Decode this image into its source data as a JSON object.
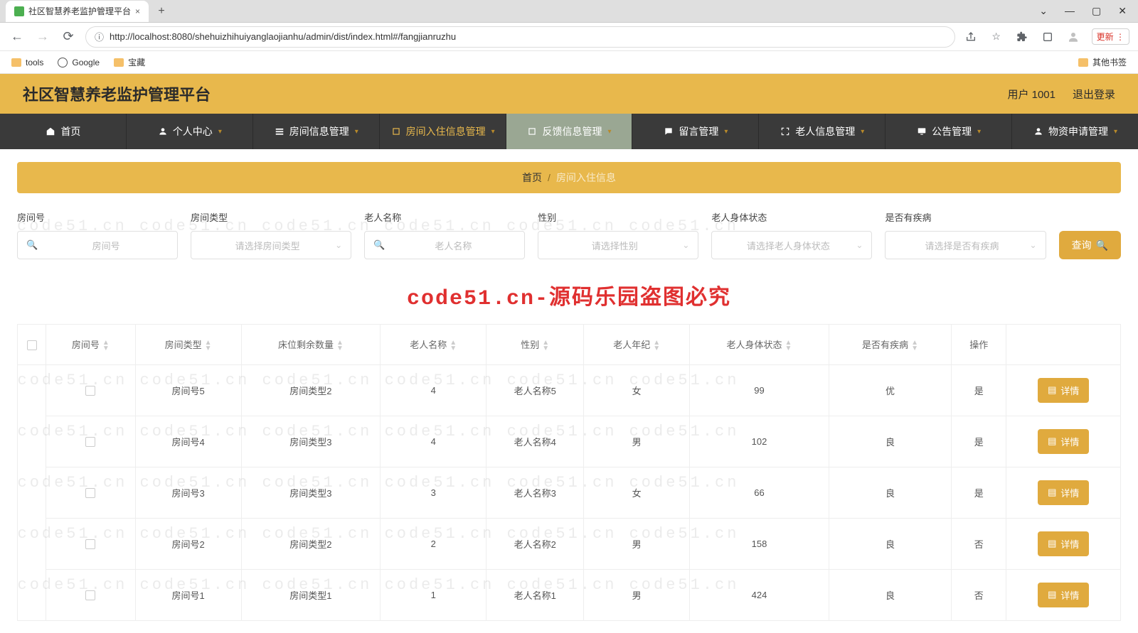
{
  "browser": {
    "tab_title": "社区智慧养老监护管理平台",
    "url": "http://localhost:8080/shehuizhihuiyanglaojianhu/admin/dist/index.html#/fangjianruzhu",
    "update_label": "更新",
    "bookmarks": {
      "tools": "tools",
      "google": "Google",
      "baozang": "宝藏",
      "other": "其他书签"
    }
  },
  "header": {
    "title": "社区智慧养老监护管理平台",
    "user_label": "用户 1001",
    "logout": "退出登录"
  },
  "nav": {
    "home": "首页",
    "profile": "个人中心",
    "room_info": "房间信息管理",
    "room_checkin": "房间入住信息管理",
    "feedback": "反馈信息管理",
    "message": "留言管理",
    "elder_info": "老人信息管理",
    "notice": "公告管理",
    "material": "物资申请管理"
  },
  "breadcrumb": {
    "home": "首页",
    "sep": "/",
    "current": "房间入住信息"
  },
  "filters": {
    "room_no_label": "房间号",
    "room_no_ph": "房间号",
    "room_type_label": "房间类型",
    "room_type_ph": "请选择房间类型",
    "elder_name_label": "老人名称",
    "elder_name_ph": "老人名称",
    "gender_label": "性别",
    "gender_ph": "请选择性别",
    "body_label": "老人身体状态",
    "body_ph": "请选择老人身体状态",
    "disease_label": "是否有疾病",
    "disease_ph": "请选择是否有疾病",
    "query_btn": "查询"
  },
  "watermark_center": "code51.cn-源码乐园盗图必究",
  "table": {
    "headers": {
      "room_no": "房间号",
      "room_type": "房间类型",
      "beds_left": "床位剩余数量",
      "elder_name": "老人名称",
      "gender": "性别",
      "age": "老人年纪",
      "body": "老人身体状态",
      "disease": "是否有疾病",
      "ops": "操作"
    },
    "detail_btn": "详情",
    "rows": [
      {
        "room_no": "房间号5",
        "room_type": "房间类型2",
        "beds_left": "4",
        "elder_name": "老人名称5",
        "gender": "女",
        "age": "99",
        "body": "优",
        "disease": "是"
      },
      {
        "room_no": "房间号4",
        "room_type": "房间类型3",
        "beds_left": "4",
        "elder_name": "老人名称4",
        "gender": "男",
        "age": "102",
        "body": "良",
        "disease": "是"
      },
      {
        "room_no": "房间号3",
        "room_type": "房间类型3",
        "beds_left": "3",
        "elder_name": "老人名称3",
        "gender": "女",
        "age": "66",
        "body": "良",
        "disease": "是"
      },
      {
        "room_no": "房间号2",
        "room_type": "房间类型2",
        "beds_left": "2",
        "elder_name": "老人名称2",
        "gender": "男",
        "age": "158",
        "body": "良",
        "disease": "否"
      },
      {
        "room_no": "房间号1",
        "room_type": "房间类型1",
        "beds_left": "1",
        "elder_name": "老人名称1",
        "gender": "男",
        "age": "424",
        "body": "良",
        "disease": "否"
      }
    ]
  }
}
